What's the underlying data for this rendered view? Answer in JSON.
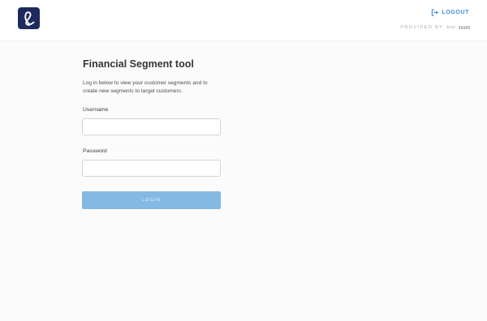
{
  "header": {
    "logo_icon": "cursive-l-logo-icon",
    "brand_color": "#1e2a5e",
    "logout_label": "LOGOUT",
    "logout_icon": "logout-arrow-icon",
    "logout_color": "#3d8fd6",
    "provided_by_label": "PROVIDED BY",
    "provided_by_brand": "bud"
  },
  "login": {
    "title": "Financial Segment tool",
    "description": "Log in below to view your customer segments and to create new segments to target customers.",
    "username_label": "Username",
    "username_value": "",
    "username_placeholder": "",
    "password_label": "Password",
    "password_value": "",
    "password_placeholder": "",
    "button_label": "LOGIN",
    "button_color": "#84b9e3"
  }
}
